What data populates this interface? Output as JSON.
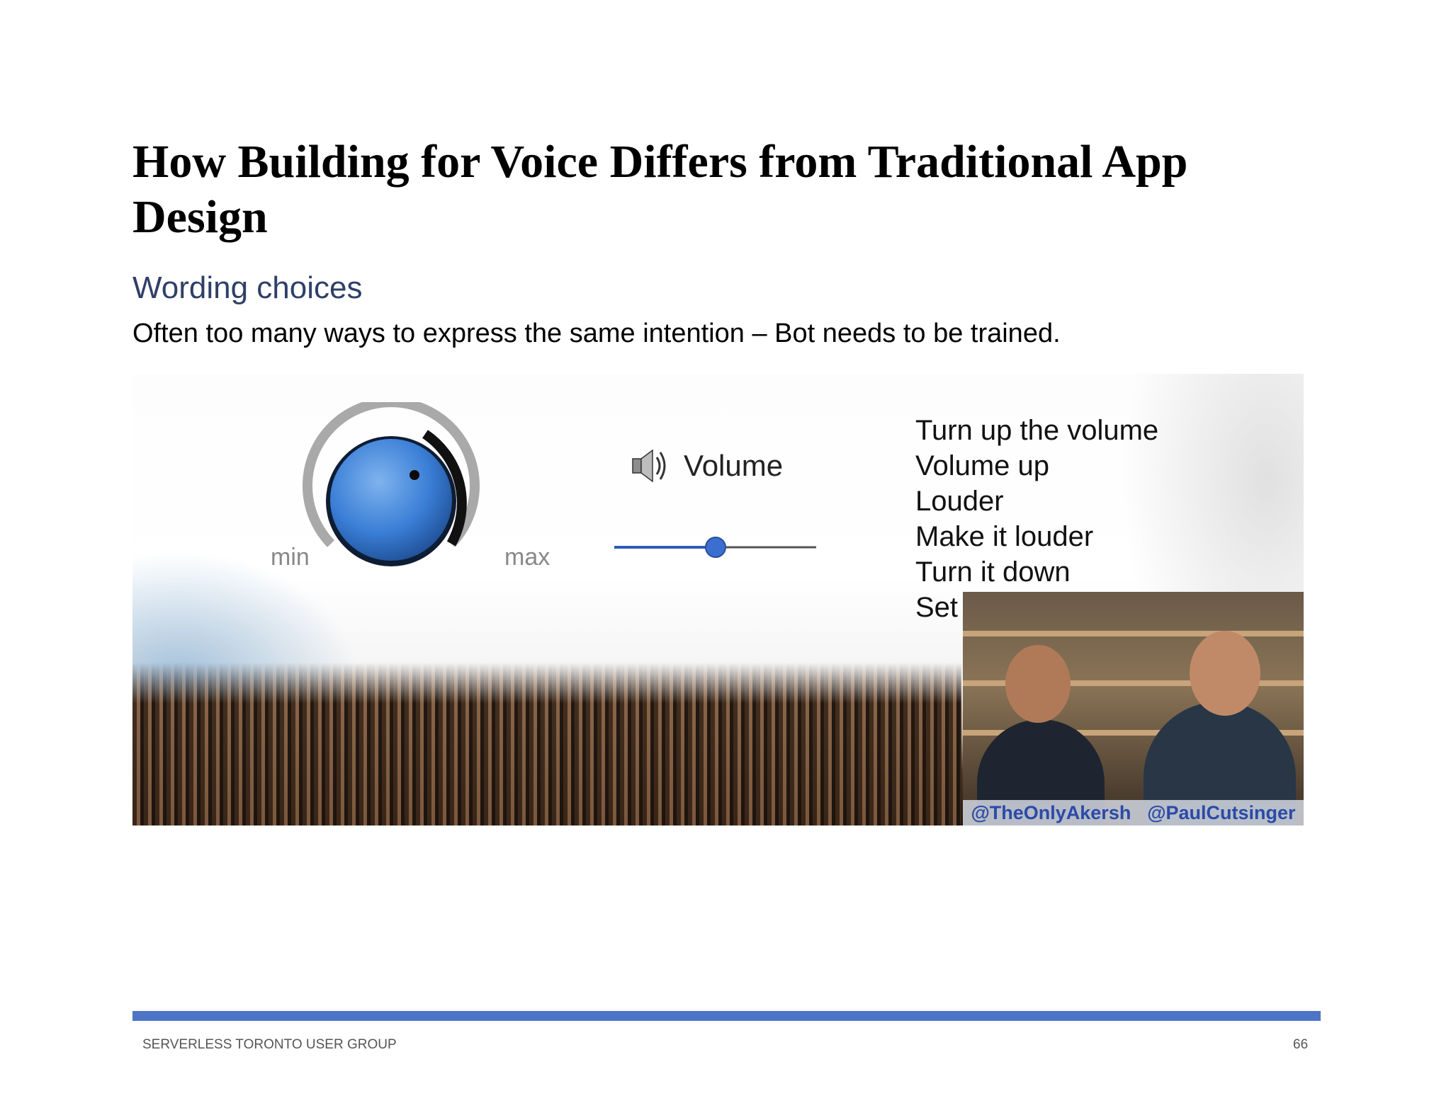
{
  "slide": {
    "title": "How Building for Voice Differs from Traditional App Design",
    "subtitle": "Wording choices",
    "body": "Often too many ways to express the same intention – Bot needs to be trained."
  },
  "image": {
    "knob_min": "min",
    "knob_max": "max",
    "speaker_label": "Volume",
    "volume_level": 0.5,
    "phrases": [
      "Turn up the volume",
      "Volume up",
      "Louder",
      "Make it louder",
      "Turn it down",
      "Set"
    ],
    "handle_left": "@TheOnlyAkersh",
    "handle_right": "@PaulCutsinger",
    "accent": "#3a78d6"
  },
  "footer": {
    "group": "SERVERLESS TORONTO USER GROUP",
    "page": "66"
  }
}
